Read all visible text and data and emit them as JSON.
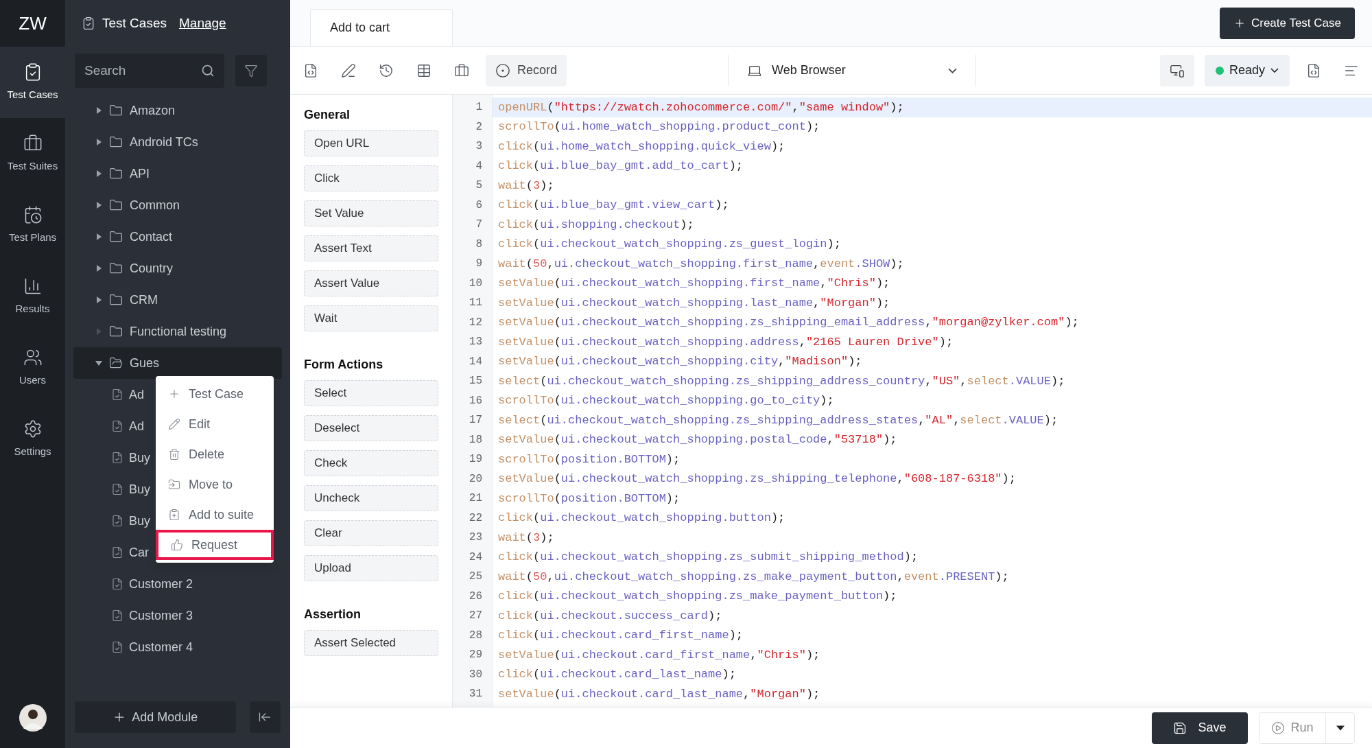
{
  "rail": {
    "logo": "ZW",
    "items": [
      {
        "label": "Test Cases",
        "selected": true
      },
      {
        "label": "Test Suites",
        "selected": false
      },
      {
        "label": "Test Plans",
        "selected": false
      },
      {
        "label": "Results",
        "selected": false
      },
      {
        "label": "Users",
        "selected": false
      },
      {
        "label": "Settings",
        "selected": false
      }
    ]
  },
  "sidebar": {
    "title": "Test Cases",
    "link": "Manage",
    "search": {
      "placeholder": "Search"
    },
    "add_button": "Add Module",
    "tree": [
      {
        "label": "Amazon",
        "kind": "folder",
        "expanded": false,
        "empty": false,
        "selected": false
      },
      {
        "label": "Android TCs",
        "kind": "folder",
        "expanded": false,
        "empty": false,
        "selected": false
      },
      {
        "label": "API",
        "kind": "folder",
        "expanded": false,
        "empty": false,
        "selected": false
      },
      {
        "label": "Common",
        "kind": "folder",
        "expanded": false,
        "empty": false,
        "selected": false
      },
      {
        "label": "Contact",
        "kind": "folder",
        "expanded": false,
        "empty": false,
        "selected": false
      },
      {
        "label": "Country",
        "kind": "folder",
        "expanded": false,
        "empty": false,
        "selected": false
      },
      {
        "label": "CRM",
        "kind": "folder",
        "expanded": false,
        "empty": false,
        "selected": false
      },
      {
        "label": "Functional testing",
        "kind": "folder",
        "expanded": false,
        "empty": true,
        "selected": false
      },
      {
        "label": "Gues",
        "kind": "folder",
        "expanded": true,
        "empty": false,
        "selected": true,
        "children": [
          {
            "label": "Ad",
            "kind": "case",
            "selected": false
          },
          {
            "label": "Ad",
            "kind": "case",
            "selected": false
          },
          {
            "label": "Buy",
            "kind": "case",
            "selected": false
          },
          {
            "label": "Buy",
            "kind": "case",
            "selected": false
          },
          {
            "label": "Buy",
            "kind": "case",
            "selected": false
          },
          {
            "label": "Car",
            "kind": "case",
            "selected": false
          },
          {
            "label": "Customer 2",
            "kind": "case",
            "selected": false
          },
          {
            "label": "Customer 3",
            "kind": "case",
            "selected": false
          },
          {
            "label": "Customer 4",
            "kind": "case",
            "selected": false
          }
        ]
      }
    ]
  },
  "context_menu": {
    "items": [
      {
        "label": "Test Case",
        "highlighted": false
      },
      {
        "label": "Edit",
        "highlighted": false
      },
      {
        "label": "Delete",
        "highlighted": false
      },
      {
        "label": "Move to",
        "highlighted": false
      },
      {
        "label": "Add to suite",
        "highlighted": false
      },
      {
        "label": "Request",
        "highlighted": true
      }
    ]
  },
  "tabs": [
    {
      "label": "Add to cart",
      "selected": true
    }
  ],
  "create_button": "Create Test Case",
  "toolbar": {
    "record": "Record",
    "browser": "Web Browser",
    "status": "Ready"
  },
  "actions": [
    {
      "title": "General",
      "items": [
        "Open URL",
        "Click",
        "Set Value",
        "Assert Text",
        "Assert Value",
        "Wait"
      ]
    },
    {
      "title": "Form Actions",
      "items": [
        "Select",
        "Deselect",
        "Check",
        "Uncheck",
        "Clear",
        "Upload"
      ]
    },
    {
      "title": "Assertion",
      "items": [
        "Assert Selected"
      ]
    }
  ],
  "editor": {
    "lines": [
      {
        "number": "1",
        "selected": true,
        "tokens": [
          {
            "kind": "function",
            "text": "openURL"
          },
          {
            "kind": "punctuation",
            "text": "("
          },
          {
            "kind": "string",
            "text": "\"https://zwatch.zohocommerce.com/\""
          },
          {
            "kind": "punctuation",
            "text": ","
          },
          {
            "kind": "string",
            "text": "\"same window\""
          },
          {
            "kind": "punctuation",
            "text": ");"
          }
        ]
      },
      {
        "number": "2",
        "selected": false,
        "tokens": [
          {
            "kind": "function",
            "text": "scrollTo"
          },
          {
            "kind": "punctuation",
            "text": "("
          },
          {
            "kind": "identifier",
            "text": "ui.home_watch_shopping.product_cont"
          },
          {
            "kind": "punctuation",
            "text": ");"
          }
        ]
      },
      {
        "number": "3",
        "selected": false,
        "tokens": [
          {
            "kind": "function",
            "text": "click"
          },
          {
            "kind": "punctuation",
            "text": "("
          },
          {
            "kind": "identifier",
            "text": "ui.home_watch_shopping.quick_view"
          },
          {
            "kind": "punctuation",
            "text": ");"
          }
        ]
      },
      {
        "number": "4",
        "selected": false,
        "tokens": [
          {
            "kind": "function",
            "text": "click"
          },
          {
            "kind": "punctuation",
            "text": "("
          },
          {
            "kind": "identifier",
            "text": "ui.blue_bay_gmt.add_to_cart"
          },
          {
            "kind": "punctuation",
            "text": ");"
          }
        ]
      },
      {
        "number": "5",
        "selected": false,
        "tokens": [
          {
            "kind": "function",
            "text": "wait"
          },
          {
            "kind": "punctuation",
            "text": "("
          },
          {
            "kind": "number",
            "text": "3"
          },
          {
            "kind": "punctuation",
            "text": ");"
          }
        ]
      },
      {
        "number": "6",
        "selected": false,
        "tokens": [
          {
            "kind": "function",
            "text": "click"
          },
          {
            "kind": "punctuation",
            "text": "("
          },
          {
            "kind": "identifier",
            "text": "ui.blue_bay_gmt.view_cart"
          },
          {
            "kind": "punctuation",
            "text": ");"
          }
        ]
      },
      {
        "number": "7",
        "selected": false,
        "tokens": [
          {
            "kind": "function",
            "text": "click"
          },
          {
            "kind": "punctuation",
            "text": "("
          },
          {
            "kind": "identifier",
            "text": "ui.shopping.checkout"
          },
          {
            "kind": "punctuation",
            "text": ");"
          }
        ]
      },
      {
        "number": "8",
        "selected": false,
        "tokens": [
          {
            "kind": "function",
            "text": "click"
          },
          {
            "kind": "punctuation",
            "text": "("
          },
          {
            "kind": "identifier",
            "text": "ui.checkout_watch_shopping.zs_guest_login"
          },
          {
            "kind": "punctuation",
            "text": ");"
          }
        ]
      },
      {
        "number": "9",
        "selected": false,
        "tokens": [
          {
            "kind": "function",
            "text": "wait"
          },
          {
            "kind": "punctuation",
            "text": "("
          },
          {
            "kind": "number",
            "text": "50"
          },
          {
            "kind": "punctuation",
            "text": ","
          },
          {
            "kind": "identifier",
            "text": "ui.checkout_watch_shopping.first_name"
          },
          {
            "kind": "punctuation",
            "text": ","
          },
          {
            "kind": "function",
            "text": "event"
          },
          {
            "kind": "identifier",
            "text": ".SHOW"
          },
          {
            "kind": "punctuation",
            "text": ");"
          }
        ]
      },
      {
        "number": "10",
        "selected": false,
        "tokens": [
          {
            "kind": "function",
            "text": "setValue"
          },
          {
            "kind": "punctuation",
            "text": "("
          },
          {
            "kind": "identifier",
            "text": "ui.checkout_watch_shopping.first_name"
          },
          {
            "kind": "punctuation",
            "text": ","
          },
          {
            "kind": "string",
            "text": "\"Chris\""
          },
          {
            "kind": "punctuation",
            "text": ");"
          }
        ]
      },
      {
        "number": "11",
        "selected": false,
        "tokens": [
          {
            "kind": "function",
            "text": "setValue"
          },
          {
            "kind": "punctuation",
            "text": "("
          },
          {
            "kind": "identifier",
            "text": "ui.checkout_watch_shopping.last_name"
          },
          {
            "kind": "punctuation",
            "text": ","
          },
          {
            "kind": "string",
            "text": "\"Morgan\""
          },
          {
            "kind": "punctuation",
            "text": ");"
          }
        ]
      },
      {
        "number": "12",
        "selected": false,
        "tokens": [
          {
            "kind": "function",
            "text": "setValue"
          },
          {
            "kind": "punctuation",
            "text": "("
          },
          {
            "kind": "identifier",
            "text": "ui.checkout_watch_shopping.zs_shipping_email_address"
          },
          {
            "kind": "punctuation",
            "text": ","
          },
          {
            "kind": "string",
            "text": "\"morgan@zylker.com\""
          },
          {
            "kind": "punctuation",
            "text": ");"
          }
        ]
      },
      {
        "number": "13",
        "selected": false,
        "tokens": [
          {
            "kind": "function",
            "text": "setValue"
          },
          {
            "kind": "punctuation",
            "text": "("
          },
          {
            "kind": "identifier",
            "text": "ui.checkout_watch_shopping.address"
          },
          {
            "kind": "punctuation",
            "text": ","
          },
          {
            "kind": "string",
            "text": "\"2165 Lauren Drive\""
          },
          {
            "kind": "punctuation",
            "text": ");"
          }
        ]
      },
      {
        "number": "14",
        "selected": false,
        "tokens": [
          {
            "kind": "function",
            "text": "setValue"
          },
          {
            "kind": "punctuation",
            "text": "("
          },
          {
            "kind": "identifier",
            "text": "ui.checkout_watch_shopping.city"
          },
          {
            "kind": "punctuation",
            "text": ","
          },
          {
            "kind": "string",
            "text": "\"Madison\""
          },
          {
            "kind": "punctuation",
            "text": ");"
          }
        ]
      },
      {
        "number": "15",
        "selected": false,
        "tokens": [
          {
            "kind": "function",
            "text": "select"
          },
          {
            "kind": "punctuation",
            "text": "("
          },
          {
            "kind": "identifier",
            "text": "ui.checkout_watch_shopping.zs_shipping_address_country"
          },
          {
            "kind": "punctuation",
            "text": ","
          },
          {
            "kind": "string",
            "text": "\"US\""
          },
          {
            "kind": "punctuation",
            "text": ","
          },
          {
            "kind": "function",
            "text": "select"
          },
          {
            "kind": "identifier",
            "text": ".VALUE"
          },
          {
            "kind": "punctuation",
            "text": ");"
          }
        ]
      },
      {
        "number": "16",
        "selected": false,
        "tokens": [
          {
            "kind": "function",
            "text": "scrollTo"
          },
          {
            "kind": "punctuation",
            "text": "("
          },
          {
            "kind": "identifier",
            "text": "ui.checkout_watch_shopping.go_to_city"
          },
          {
            "kind": "punctuation",
            "text": ");"
          }
        ]
      },
      {
        "number": "17",
        "selected": false,
        "tokens": [
          {
            "kind": "function",
            "text": "select"
          },
          {
            "kind": "punctuation",
            "text": "("
          },
          {
            "kind": "identifier",
            "text": "ui.checkout_watch_shopping.zs_shipping_address_states"
          },
          {
            "kind": "punctuation",
            "text": ","
          },
          {
            "kind": "string",
            "text": "\"AL\""
          },
          {
            "kind": "punctuation",
            "text": ","
          },
          {
            "kind": "function",
            "text": "select"
          },
          {
            "kind": "identifier",
            "text": ".VALUE"
          },
          {
            "kind": "punctuation",
            "text": ");"
          }
        ]
      },
      {
        "number": "18",
        "selected": false,
        "tokens": [
          {
            "kind": "function",
            "text": "setValue"
          },
          {
            "kind": "punctuation",
            "text": "("
          },
          {
            "kind": "identifier",
            "text": "ui.checkout_watch_shopping.postal_code"
          },
          {
            "kind": "punctuation",
            "text": ","
          },
          {
            "kind": "string",
            "text": "\"53718\""
          },
          {
            "kind": "punctuation",
            "text": ");"
          }
        ]
      },
      {
        "number": "19",
        "selected": false,
        "tokens": [
          {
            "kind": "function",
            "text": "scrollTo"
          },
          {
            "kind": "punctuation",
            "text": "("
          },
          {
            "kind": "identifier",
            "text": "position.BOTTOM"
          },
          {
            "kind": "punctuation",
            "text": ");"
          }
        ]
      },
      {
        "number": "20",
        "selected": false,
        "tokens": [
          {
            "kind": "function",
            "text": "setValue"
          },
          {
            "kind": "punctuation",
            "text": "("
          },
          {
            "kind": "identifier",
            "text": "ui.checkout_watch_shopping.zs_shipping_telephone"
          },
          {
            "kind": "punctuation",
            "text": ","
          },
          {
            "kind": "string",
            "text": "\"608-187-6318\""
          },
          {
            "kind": "punctuation",
            "text": ");"
          }
        ]
      },
      {
        "number": "21",
        "selected": false,
        "tokens": [
          {
            "kind": "function",
            "text": "scrollTo"
          },
          {
            "kind": "punctuation",
            "text": "("
          },
          {
            "kind": "identifier",
            "text": "position.BOTTOM"
          },
          {
            "kind": "punctuation",
            "text": ");"
          }
        ]
      },
      {
        "number": "22",
        "selected": false,
        "tokens": [
          {
            "kind": "function",
            "text": "click"
          },
          {
            "kind": "punctuation",
            "text": "("
          },
          {
            "kind": "identifier",
            "text": "ui.checkout_watch_shopping.button"
          },
          {
            "kind": "punctuation",
            "text": ");"
          }
        ]
      },
      {
        "number": "23",
        "selected": false,
        "tokens": [
          {
            "kind": "function",
            "text": "wait"
          },
          {
            "kind": "punctuation",
            "text": "("
          },
          {
            "kind": "number",
            "text": "3"
          },
          {
            "kind": "punctuation",
            "text": ");"
          }
        ]
      },
      {
        "number": "24",
        "selected": false,
        "tokens": [
          {
            "kind": "function",
            "text": "click"
          },
          {
            "kind": "punctuation",
            "text": "("
          },
          {
            "kind": "identifier",
            "text": "ui.checkout_watch_shopping.zs_submit_shipping_method"
          },
          {
            "kind": "punctuation",
            "text": ");"
          }
        ]
      },
      {
        "number": "25",
        "selected": false,
        "tokens": [
          {
            "kind": "function",
            "text": "wait"
          },
          {
            "kind": "punctuation",
            "text": "("
          },
          {
            "kind": "number",
            "text": "50"
          },
          {
            "kind": "punctuation",
            "text": ","
          },
          {
            "kind": "identifier",
            "text": "ui.checkout_watch_shopping.zs_make_payment_button"
          },
          {
            "kind": "punctuation",
            "text": ","
          },
          {
            "kind": "function",
            "text": "event"
          },
          {
            "kind": "identifier",
            "text": ".PRESENT"
          },
          {
            "kind": "punctuation",
            "text": ");"
          }
        ]
      },
      {
        "number": "26",
        "selected": false,
        "tokens": [
          {
            "kind": "function",
            "text": "click"
          },
          {
            "kind": "punctuation",
            "text": "("
          },
          {
            "kind": "identifier",
            "text": "ui.checkout_watch_shopping.zs_make_payment_button"
          },
          {
            "kind": "punctuation",
            "text": ");"
          }
        ]
      },
      {
        "number": "27",
        "selected": false,
        "tokens": [
          {
            "kind": "function",
            "text": "click"
          },
          {
            "kind": "punctuation",
            "text": "("
          },
          {
            "kind": "identifier",
            "text": "ui.checkout.success_card"
          },
          {
            "kind": "punctuation",
            "text": ");"
          }
        ]
      },
      {
        "number": "28",
        "selected": false,
        "tokens": [
          {
            "kind": "function",
            "text": "click"
          },
          {
            "kind": "punctuation",
            "text": "("
          },
          {
            "kind": "identifier",
            "text": "ui.checkout.card_first_name"
          },
          {
            "kind": "punctuation",
            "text": ");"
          }
        ]
      },
      {
        "number": "29",
        "selected": false,
        "tokens": [
          {
            "kind": "function",
            "text": "setValue"
          },
          {
            "kind": "punctuation",
            "text": "("
          },
          {
            "kind": "identifier",
            "text": "ui.checkout.card_first_name"
          },
          {
            "kind": "punctuation",
            "text": ","
          },
          {
            "kind": "string",
            "text": "\"Chris\""
          },
          {
            "kind": "punctuation",
            "text": ");"
          }
        ]
      },
      {
        "number": "30",
        "selected": false,
        "tokens": [
          {
            "kind": "function",
            "text": "click"
          },
          {
            "kind": "punctuation",
            "text": "("
          },
          {
            "kind": "identifier",
            "text": "ui.checkout.card_last_name"
          },
          {
            "kind": "punctuation",
            "text": ");"
          }
        ]
      },
      {
        "number": "31",
        "selected": false,
        "tokens": [
          {
            "kind": "function",
            "text": "setValue"
          },
          {
            "kind": "punctuation",
            "text": "("
          },
          {
            "kind": "identifier",
            "text": "ui.checkout.card_last_name"
          },
          {
            "kind": "punctuation",
            "text": ","
          },
          {
            "kind": "string",
            "text": "\"Morgan\""
          },
          {
            "kind": "punctuation",
            "text": ");"
          }
        ]
      }
    ]
  },
  "footer": {
    "save": "Save",
    "run": "Run"
  }
}
